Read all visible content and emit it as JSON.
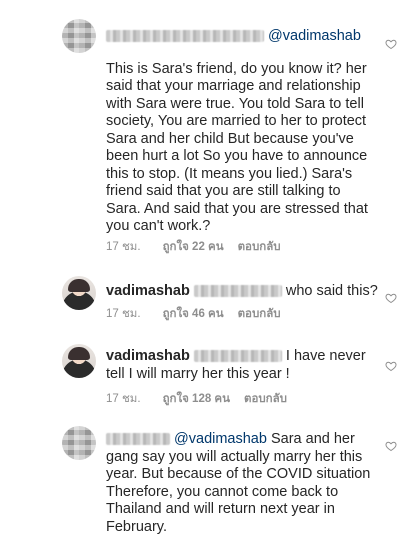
{
  "comments": [
    {
      "username_blur": true,
      "mention": "@vadimashab",
      "text": "This is Sara's friend, do you know it?  her said that your marriage and relationship with Sara were true. You told Sara to tell society,  You are married to her to protect Sara and her child  But because you've been hurt a lot  So you have to announce this to stop. (It means you lied.) Sara's friend said that you are still talking to Sara.  And said that you are stressed that you can't work.?",
      "time": "17 ชม.",
      "likes": "ถูกใจ 22 คน",
      "reply": "ตอบกลับ"
    },
    {
      "username": "vadimashab",
      "text": "who said this?",
      "time": "17 ชม.",
      "likes": "ถูกใจ 46 คน",
      "reply": "ตอบกลับ"
    },
    {
      "username": "vadimashab",
      "text": "I have never tell I will marry her this year !",
      "time": "17 ชม.",
      "likes": "ถูกใจ 128 คน",
      "reply": "ตอบกลับ"
    },
    {
      "username_blur": true,
      "mention": "@vadimashab",
      "text": "Sara and her gang say you will actually marry her this year.  But because of the COVID situation  Therefore, you cannot come back to Thailand and will return next year in February."
    }
  ],
  "icons": {
    "like": "heart-outline-icon"
  }
}
